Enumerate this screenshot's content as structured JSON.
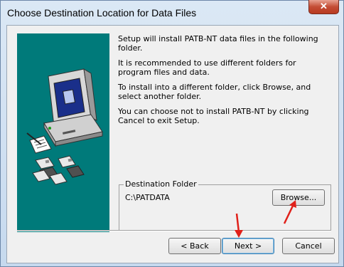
{
  "window": {
    "title": "Choose Destination Location for Data Files"
  },
  "titlebar": {
    "close_glyph": "✕"
  },
  "description": {
    "paragraphs": [
      "Setup will install PATB-NT data files in the following folder.",
      "It is recommended to use different folders for program files and data.",
      "To install into a different folder, click Browse, and select another folder.",
      "You can choose not to install PATB-NT by clicking Cancel to exit Setup."
    ]
  },
  "destination": {
    "group_label": "Destination Folder",
    "path": "C:\\PATDATA",
    "browse_label": "Browse..."
  },
  "buttons": {
    "back_label": "< Back",
    "next_label": "Next >",
    "cancel_label": "Cancel"
  },
  "colors": {
    "art_background": "#007a7a",
    "annotation_arrow": "#e0201a"
  },
  "icons": [
    "close-icon",
    "computer-illustration",
    "red-arrow-annotation"
  ]
}
